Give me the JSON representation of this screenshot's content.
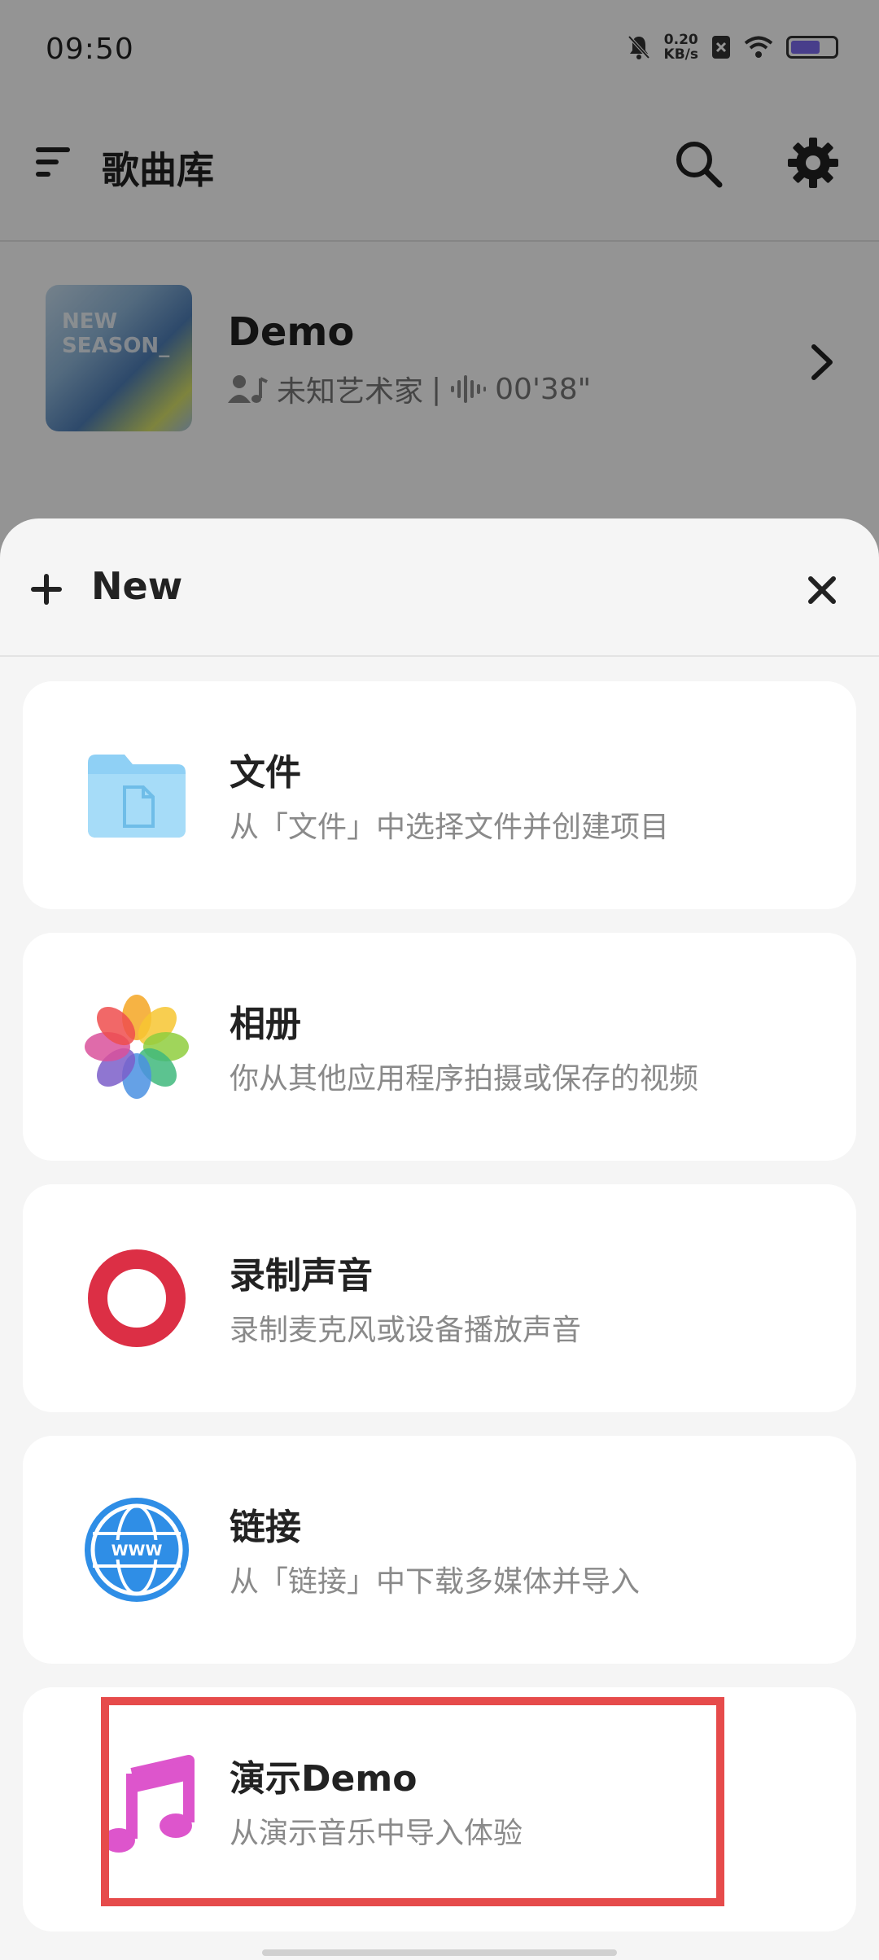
{
  "status_bar": {
    "time": "09:50",
    "speed_value": "0.20",
    "speed_unit": "KB/s"
  },
  "header": {
    "title": "歌曲库"
  },
  "song": {
    "title": "Demo",
    "artist": "未知艺术家",
    "separator": "|",
    "duration": "00'38\"",
    "album_text": "NEW SEASON_"
  },
  "sheet": {
    "title": "New",
    "items": [
      {
        "title": "文件",
        "desc": "从「文件」中选择文件并创建项目",
        "icon": "folder-icon"
      },
      {
        "title": "相册",
        "desc": "你从其他应用程序拍摄或保存的视频",
        "icon": "photos-icon"
      },
      {
        "title": "录制声音",
        "desc": "录制麦克风或设备播放声音",
        "icon": "record-icon"
      },
      {
        "title": "链接",
        "desc": "从「链接」中下载多媒体并导入",
        "icon": "globe-icon"
      },
      {
        "title": "演示Demo",
        "desc": "从演示音乐中导入体验",
        "icon": "music-note-icon"
      }
    ]
  },
  "colors": {
    "highlight": "#e64b4b",
    "record": "#dc2f45",
    "folder": "#8fd0f5",
    "globe": "#2f8ee6",
    "music": "#dd55cc"
  },
  "icon_names": [
    "menu-icon",
    "search-icon",
    "gear-icon",
    "chevron-right-icon",
    "plus-icon",
    "close-icon"
  ]
}
